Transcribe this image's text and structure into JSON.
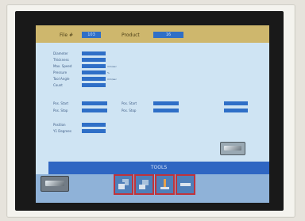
{
  "header": {
    "file_label": "File #",
    "file_value": "103",
    "product_label": "Product",
    "product_value": "16"
  },
  "params_left": [
    {
      "label": "Diameter",
      "value": "",
      "unit": ""
    },
    {
      "label": "Thickness",
      "value": "",
      "unit": ""
    },
    {
      "label": "Max. Speed",
      "value": "",
      "unit": "mm/sec"
    },
    {
      "label": "Pressure",
      "value": "",
      "unit": "%"
    },
    {
      "label": "Tool Angle",
      "value": "",
      "unit": "mm/sec"
    },
    {
      "label": "Count",
      "value": "",
      "unit": ""
    }
  ],
  "params_mid": [
    {
      "label": "Pos. Start",
      "value": "",
      "label2": "Pos. Start",
      "value2": "",
      "value3": ""
    },
    {
      "label": "Pos. Stop",
      "value": "",
      "label2": "Pos. Stop",
      "value2": "",
      "value3": ""
    }
  ],
  "params_low": [
    {
      "label": "Position",
      "value": ""
    },
    {
      "label": "Y1 Degrees",
      "value": ""
    }
  ],
  "bottom": {
    "title": "TOOLS"
  },
  "icons": [
    "tool-a-icon",
    "tool-b-icon",
    "tool-c-icon",
    "tool-d-icon"
  ],
  "colors": {
    "header_bg": "#ceb76d",
    "field_blue": "#2f6fc7",
    "screen_bg": "#cfe4f3",
    "icon_border": "#c0333b"
  }
}
